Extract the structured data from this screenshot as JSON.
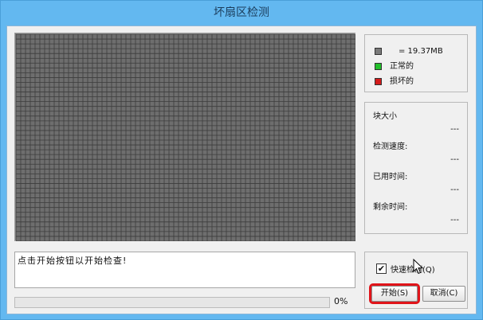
{
  "window": {
    "title": "坏扇区检测"
  },
  "grid": {
    "columns": 71,
    "rows": 43,
    "cell_color": "#6e6e6e",
    "line_color": "#3c3c3c"
  },
  "legend": {
    "items": [
      {
        "label": "= 19.37MB",
        "color": "#7a7a7a"
      },
      {
        "label": "正常的",
        "color": "#22c02a"
      },
      {
        "label": "损坏的",
        "color": "#d41b1b"
      }
    ]
  },
  "stats": {
    "block_size_label": "块大小",
    "block_size_value": "---",
    "speed_label": "检测速度:",
    "speed_value": "---",
    "elapsed_label": "已用时间:",
    "elapsed_value": "---",
    "remaining_label": "剩余时间:",
    "remaining_value": "---"
  },
  "message": "点击开始按钮以开始检查!",
  "progress": {
    "value": 0,
    "label": "0%"
  },
  "options": {
    "quick_check_label": "快速检测(Q)",
    "quick_check_checked": true
  },
  "buttons": {
    "start": "开始(S)",
    "cancel": "取消(C)"
  }
}
